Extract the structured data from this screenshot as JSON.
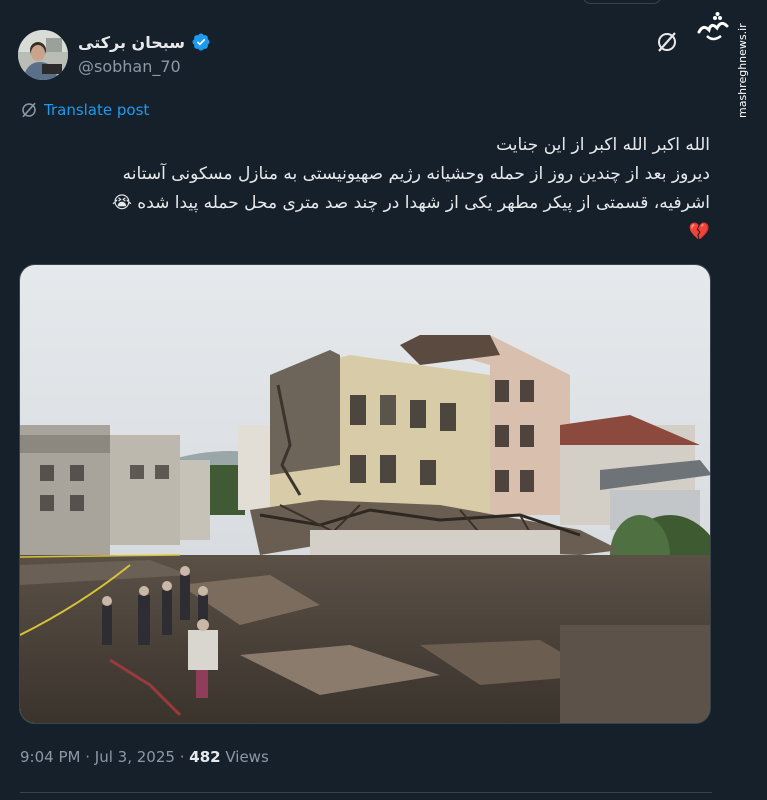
{
  "author": {
    "display_name": "سبحان برکتی",
    "handle": "@sobhan_70",
    "verified": true,
    "avatar_icon": "avatar-photo"
  },
  "actions": {
    "grok_icon": "grok-slash-icon",
    "translate_label": "Translate post"
  },
  "post": {
    "lines": [
      "الله اکبر الله اکبر از این جنایت",
      "دیروز بعد از چندین روز از حمله وحشیانه رژیم صهیونیستی به منازل مسکونی آستانه",
      "اشرفیه، قسمتی از پیکر مطهر یکی از شهدا در چند صد متری محل حمله پیدا شده"
    ],
    "emoji_cry": "😭",
    "emoji_broken_heart": "💔"
  },
  "media": {
    "alt_subject": "destroyed-residential-building-photo"
  },
  "meta": {
    "time": "9:04 PM",
    "separator": "·",
    "date": "Jul 3, 2025",
    "views_count": "482",
    "views_label": "Views"
  },
  "watermark": {
    "logo_text": "مشرق",
    "url": "mashreghnews.ir"
  },
  "colors": {
    "background": "#15202b",
    "accent": "#1d9bf0",
    "text": "#e7e9ea",
    "muted": "#8b98a5"
  }
}
